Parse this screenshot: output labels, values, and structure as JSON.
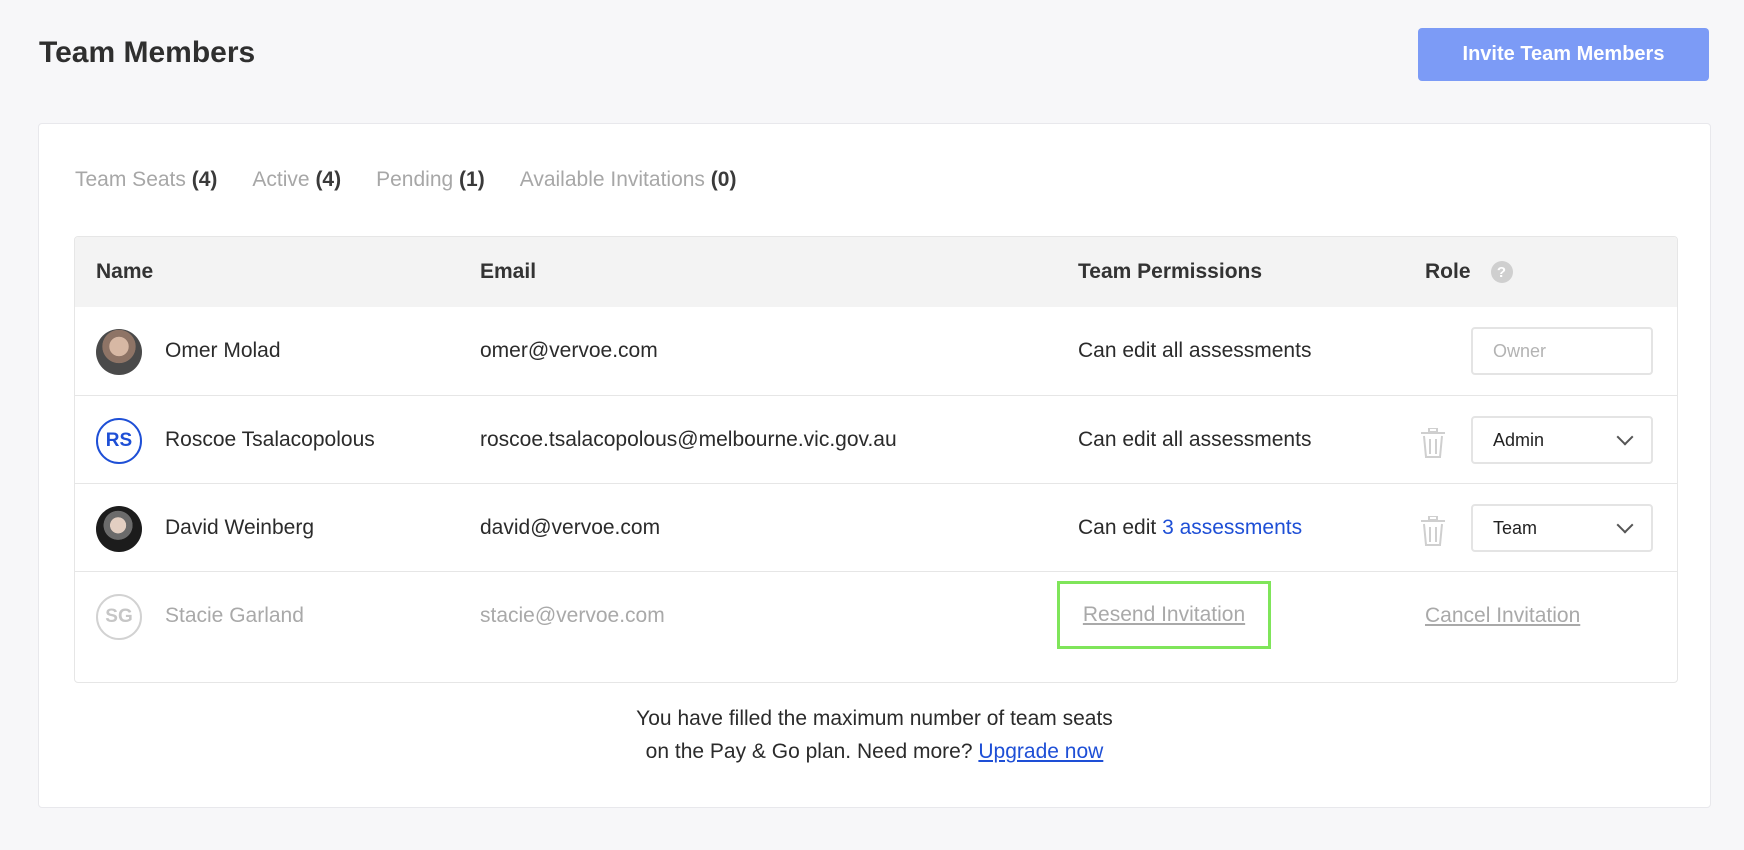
{
  "header": {
    "title": "Team Members",
    "invite_button": "Invite Team Members"
  },
  "tabs": [
    {
      "label": "Team Seats",
      "count": "(4)"
    },
    {
      "label": "Active",
      "count": "(4)"
    },
    {
      "label": "Pending",
      "count": "(1)"
    },
    {
      "label": "Available Invitations",
      "count": "(0)"
    }
  ],
  "table": {
    "headers": {
      "name": "Name",
      "email": "Email",
      "permissions": "Team Permissions",
      "role": "Role",
      "help": "?"
    },
    "rows": [
      {
        "initials": "",
        "name": "Omer Molad",
        "email": "omer@vervoe.com",
        "permissions": "Can edit all assessments",
        "role": "Owner"
      },
      {
        "initials": "RS",
        "name": "Roscoe Tsalacopolous",
        "email": "roscoe.tsalacopolous@melbourne.vic.gov.au",
        "permissions": "Can edit all assessments",
        "role": "Admin"
      },
      {
        "initials": "",
        "name": "David Weinberg",
        "email": "david@vervoe.com",
        "permissions_prefix": "Can edit",
        "permissions_link": "3 assessments",
        "role": "Team"
      },
      {
        "initials": "SG",
        "name": "Stacie Garland",
        "email": "stacie@vervoe.com",
        "resend": "Resend Invitation",
        "cancel": "Cancel Invitation"
      }
    ]
  },
  "footer": {
    "line1": "You have filled the maximum number of team seats",
    "line2": "on the Pay & Go plan. Need more?",
    "upgrade_link": "Upgrade now"
  },
  "colors": {
    "accent": "#7c9bf6",
    "link": "#1e4fd6",
    "highlight": "#7fe55a"
  }
}
